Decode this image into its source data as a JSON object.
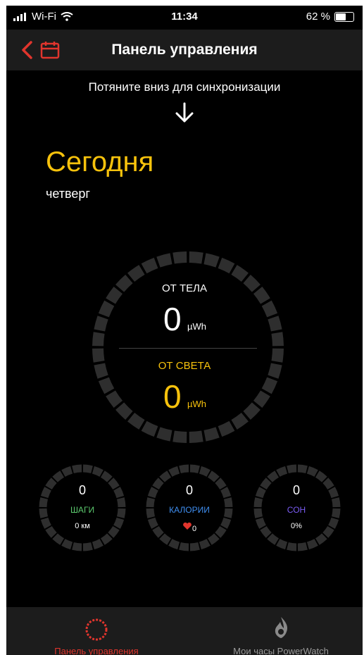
{
  "status_bar": {
    "carrier": "Wi-Fi",
    "time": "11:34",
    "battery": "62 %",
    "battery_level": 0.62
  },
  "nav": {
    "title": "Панель управления"
  },
  "pull_hint": "Потяните вниз для синхронизации",
  "today": {
    "title": "Сегодня",
    "weekday": "четверг"
  },
  "energy": {
    "body_label": "ОТ ТЕЛА",
    "body_value": "0",
    "body_unit": "µWh",
    "light_label": "ОТ СВЕТА",
    "light_value": "0",
    "light_unit": "µWh"
  },
  "stats": [
    {
      "value": "0",
      "label": "ШАГИ",
      "sub": "0 км",
      "color": "#5cc96e"
    },
    {
      "value": "0",
      "label": "КАЛОРИИ",
      "sub": "0",
      "color": "#3f8ef0"
    },
    {
      "value": "0",
      "label": "СОН",
      "sub": "0%",
      "color": "#7b5cf5"
    }
  ],
  "tabs": [
    {
      "label": "Панель управления",
      "color": "#e1352d"
    },
    {
      "label": "Мои часы PowerWatch",
      "color": "#9a9a9a"
    }
  ],
  "colors": {
    "accent_red": "#e1352d",
    "accent_yellow": "#f7c20c",
    "ring_gray": "#2e2e2e"
  }
}
